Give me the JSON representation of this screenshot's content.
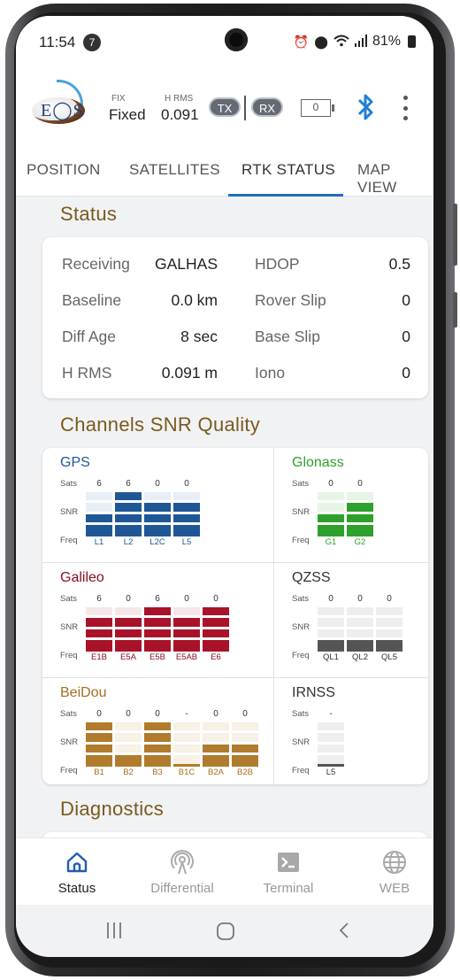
{
  "statusbar": {
    "time": "11:54",
    "notif_count": "7",
    "battery": "81%"
  },
  "header": {
    "fix_label": "FIX",
    "fix_value": "Fixed",
    "hrms_label": "H RMS",
    "hrms_value": "0.091",
    "tx_label": "TX",
    "rx_label": "RX",
    "battery_value": "0"
  },
  "tabs": [
    {
      "label": "POSITION",
      "active": false
    },
    {
      "label": "SATELLITES",
      "active": false
    },
    {
      "label": "RTK STATUS",
      "active": true
    },
    {
      "label": "MAP VIEW",
      "active": false
    }
  ],
  "status": {
    "title": "Status",
    "rows": [
      {
        "label": "Receiving",
        "value": "GALHAS",
        "label2": "HDOP",
        "value2": "0.5"
      },
      {
        "label": "Baseline",
        "value": "0.0 km",
        "label2": "Rover Slip",
        "value2": "0"
      },
      {
        "label": "Diff Age",
        "value": "8 sec",
        "label2": "Base Slip",
        "value2": "0"
      },
      {
        "label": "H RMS",
        "value": "0.091 m",
        "label2": "Iono",
        "value2": "0"
      }
    ]
  },
  "channels": {
    "title": "Channels SNR Quality",
    "row_labels": {
      "sats": "Sats",
      "snr": "SNR",
      "freq": "Freq"
    },
    "constellations": [
      {
        "name": "GPS",
        "color": "#1f5796",
        "light": "#e8eef6",
        "name_color": "#1f5796",
        "sats": [
          "6",
          "6",
          "0",
          "0"
        ],
        "freqs": [
          "L1",
          "L2",
          "L2C",
          "L5"
        ],
        "snr_levels": [
          2,
          5,
          3,
          3
        ]
      },
      {
        "name": "Glonass",
        "color": "#2ea12c",
        "light": "#e7f4e6",
        "name_color": "#2ea12c",
        "sats": [
          "0",
          "0"
        ],
        "freqs": [
          "G1",
          "G2"
        ],
        "snr_levels": [
          2,
          3
        ]
      },
      {
        "name": "Galileo",
        "color": "#a8132a",
        "light": "#f7e6e9",
        "name_color": "#8a1021",
        "sats": [
          "6",
          "0",
          "6",
          "0",
          "0"
        ],
        "freqs": [
          "E1B",
          "E5A",
          "E5B",
          "E5AB",
          "E6"
        ],
        "snr_levels": [
          3,
          3,
          4,
          3,
          4
        ]
      },
      {
        "name": "QZSS",
        "color": "#555555",
        "light": "#eeeeee",
        "name_color": "#333333",
        "sats": [
          "0",
          "0",
          "0"
        ],
        "freqs": [
          "QL1",
          "QL2",
          "QL5"
        ],
        "snr_levels": [
          1,
          1,
          1
        ]
      },
      {
        "name": "BeiDou",
        "color": "#b07b2c",
        "light": "#f7f1e6",
        "name_color": "#a46f1f",
        "sats": [
          "0",
          "0",
          "0",
          "-",
          "0",
          "0"
        ],
        "freqs": [
          "B1",
          "B2",
          "B3",
          "B1C",
          "B2A",
          "B2B"
        ],
        "snr_levels": [
          4,
          1,
          4,
          0,
          2,
          2
        ]
      },
      {
        "name": "IRNSS",
        "color": "#555555",
        "light": "#eeeeee",
        "name_color": "#333333",
        "sats": [
          "-"
        ],
        "freqs": [
          "L5"
        ],
        "snr_levels": [
          0
        ]
      }
    ]
  },
  "diagnostics": {
    "title": "Diagnostics"
  },
  "bottom_nav": [
    {
      "label": "Status",
      "icon": "home-icon",
      "active": true
    },
    {
      "label": "Differential",
      "icon": "antenna-icon",
      "active": false
    },
    {
      "label": "Terminal",
      "icon": "terminal-icon",
      "active": false
    },
    {
      "label": "WEB",
      "icon": "globe-icon",
      "active": false
    }
  ]
}
